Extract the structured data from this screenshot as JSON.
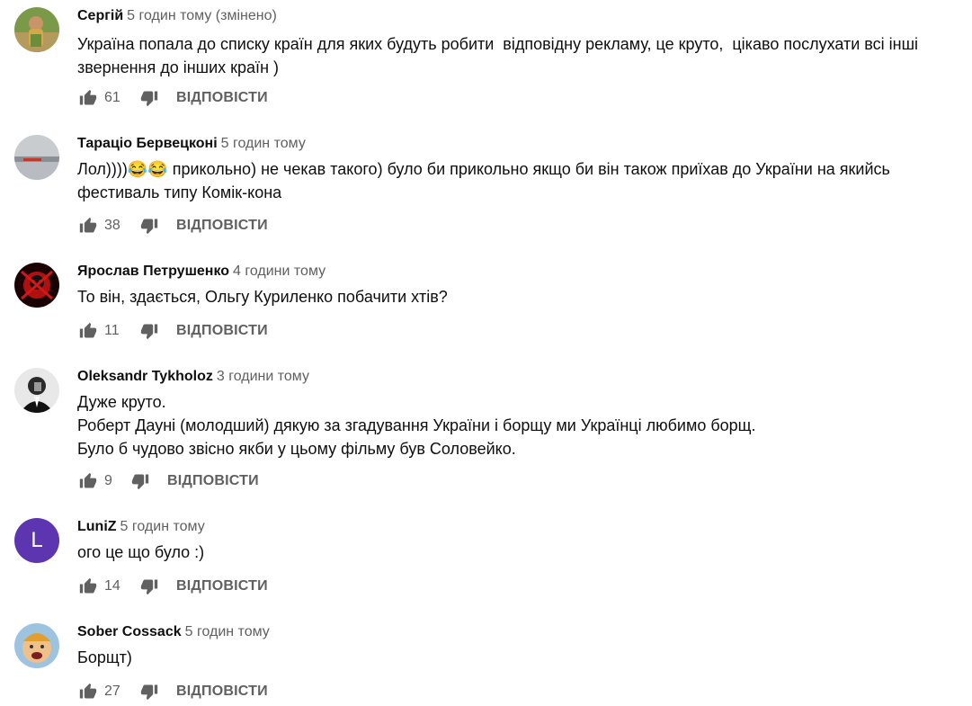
{
  "comments": [
    {
      "author": "Сергій",
      "time": "5 годин тому (змінено)",
      "text": "Україна попала до списку країн для яких будуть робити  відповідну рекламу, це круто,  цікаво послухати всі інші звернення до інших країн )",
      "likes": "61",
      "reply_label": "ВІДПОВІСТИ"
    },
    {
      "author": "Тараціо Бервецконі",
      "time": "5 годин тому",
      "text": "Лол))))😂😂 прикольно) не чекав такого) було би прикольно якщо би він також приїхав до України на якийсь  фестиваль типу Комік-кона",
      "likes": "38",
      "reply_label": "ВІДПОВІСТИ"
    },
    {
      "author": "Ярослав Петрушенко",
      "time": "4 години тому",
      "text": "То він, здається, Ольгу Куриленко побачити хтів?",
      "likes": "11",
      "reply_label": "ВІДПОВІСТИ"
    },
    {
      "author": "Oleksandr Tykholoz",
      "time": "3 години тому",
      "text": "Дуже круто.\nРоберт Дауні (молодший) дякую за згадування України і борщу ми Українці любимо борщ.\nБуло б чудово звісно якби у цьому фільму був Соловейко.",
      "likes": "9",
      "reply_label": "ВІДПОВІСТИ"
    },
    {
      "author": "LuniZ",
      "time": "5 годин тому",
      "text": "ого це що було :)",
      "likes": "14",
      "reply_label": "ВІДПОВІСТИ",
      "avatar_letter": "L",
      "avatar_color": "#5e35b1"
    },
    {
      "author": "Sober Cossack",
      "time": "5 годин тому",
      "text": "Борщт)",
      "likes": "27",
      "reply_label": "ВІДПОВІСТИ"
    }
  ],
  "colors": {
    "meta": "#606060",
    "text": "#0f0f0f"
  }
}
